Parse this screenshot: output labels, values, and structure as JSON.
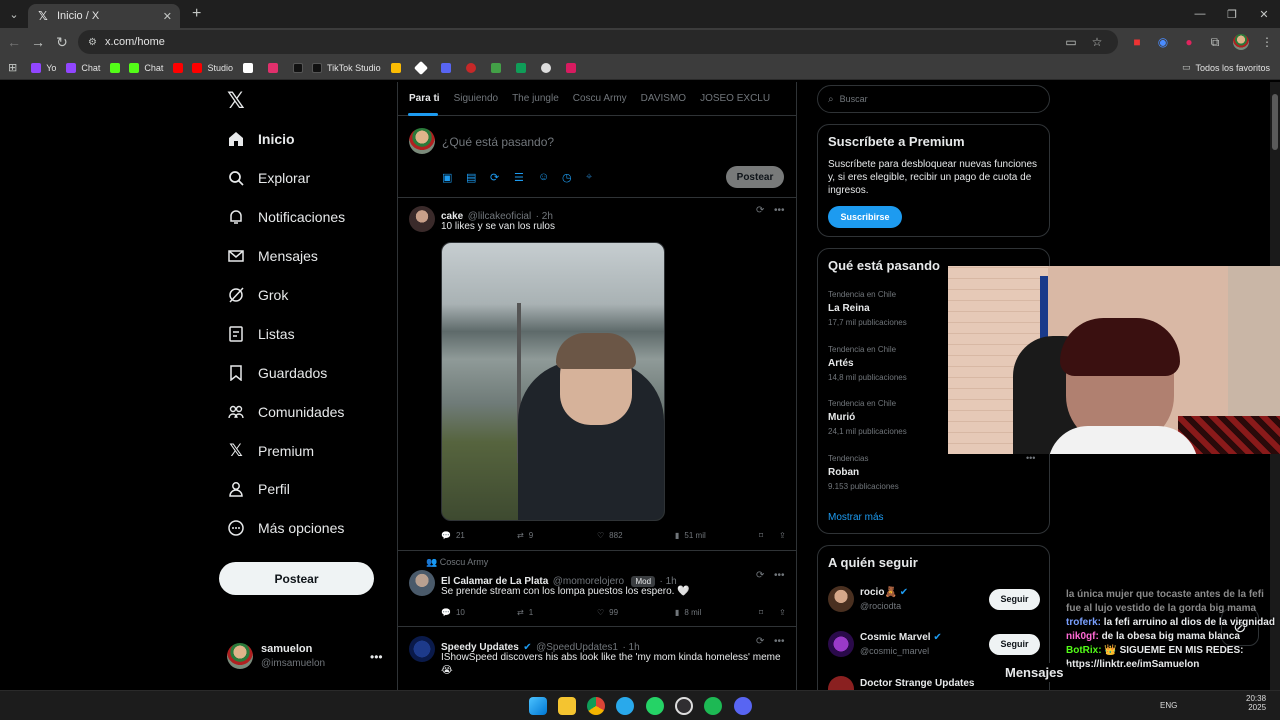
{
  "browser": {
    "tab_title": "Inicio / X",
    "url": "x.com/home",
    "bookmarks": [
      "Yo",
      "Chat",
      "Chat",
      "Studio",
      "TikTok Studio"
    ],
    "all_favorites": "Todos los favoritos"
  },
  "sidebar": {
    "items": [
      {
        "label": "Inicio",
        "icon": "home-icon"
      },
      {
        "label": "Explorar",
        "icon": "search-icon"
      },
      {
        "label": "Notificaciones",
        "icon": "bell-icon"
      },
      {
        "label": "Mensajes",
        "icon": "envelope-icon"
      },
      {
        "label": "Grok",
        "icon": "grok-icon"
      },
      {
        "label": "Listas",
        "icon": "list-icon"
      },
      {
        "label": "Guardados",
        "icon": "bookmark-icon"
      },
      {
        "label": "Comunidades",
        "icon": "people-icon"
      },
      {
        "label": "Premium",
        "icon": "x-icon"
      },
      {
        "label": "Perfil",
        "icon": "person-icon"
      },
      {
        "label": "Más opciones",
        "icon": "more-circle-icon"
      }
    ],
    "post_button": "Postear",
    "account": {
      "name": "samuelon",
      "handle": "@imsamuelon"
    }
  },
  "feed": {
    "tabs": [
      "Para ti",
      "Siguiendo",
      "The jungle",
      "Coscu Army",
      "DAVISMO",
      "JOSEO EXCLU"
    ],
    "composer_placeholder": "¿Qué está pasando?",
    "composer_post": "Postear",
    "tweets": [
      {
        "name": "cake",
        "handle": "@lilcakeoficial",
        "time": "· 2h",
        "text": "10 likes y se van los rulos",
        "replies": "21",
        "retweets": "9",
        "likes": "882",
        "views": "51 mil"
      },
      {
        "community": "Coscu Army",
        "name": "El Calamar de La Plata",
        "handle": "@momorelojero",
        "badge": "Mod",
        "time": "· 1h",
        "text": "Se prende stream con los lompa puestos los espero. 🤍",
        "replies": "10",
        "retweets": "1",
        "likes": "99",
        "views": "8 mil"
      },
      {
        "name": "Speedy Updates",
        "handle": "@SpeedUpdates1",
        "time": "· 1h",
        "text": "IShowSpeed discovers his abs look like the 'my mom kinda homeless' meme",
        "emoji": "😭"
      }
    ]
  },
  "right": {
    "search_placeholder": "Buscar",
    "premium": {
      "title": "Suscríbete a Premium",
      "text": "Suscríbete para desbloquear nuevas funciones y, si eres elegible, recibir un pago de cuota de ingresos.",
      "button": "Suscribirse"
    },
    "trends_title": "Qué está pasando",
    "trends": [
      {
        "context": "Tendencia en Chile",
        "name": "La Reina",
        "count": "17,7 mil publicaciones"
      },
      {
        "context": "Tendencia en Chile",
        "name": "Artés",
        "count": "14,8 mil publicaciones"
      },
      {
        "context": "Tendencia en Chile",
        "name": "Murió",
        "count": "24,1 mil publicaciones"
      },
      {
        "context": "Tendencias",
        "name": "Roban",
        "count": "9.153 publicaciones"
      }
    ],
    "show_more": "Mostrar más",
    "follow_title": "A quién seguir",
    "follow": [
      {
        "name": "rocio🧸",
        "handle": "@rociodta",
        "button": "Seguir"
      },
      {
        "name": "Cosmic Marvel",
        "handle": "@cosmic_marvel",
        "button": "Seguir"
      },
      {
        "name": "Doctor Strange Updates",
        "handle": ""
      }
    ]
  },
  "messages_bar": "Mensajes",
  "overlay_chat": [
    {
      "user": "",
      "text": "la única mujer que tocaste antes de la fefi fue al lujo vestido de la gorda big mama"
    },
    {
      "user": "troferk:",
      "text": "la fefi arruino al dios de la virgnidad"
    },
    {
      "user": "nik0gf:",
      "text": "de la obesa big mama blanca"
    },
    {
      "user": "BotRix:",
      "text": "👑 SIGUEME EN MIS REDES: https://linktr.ee/imSamuelon"
    }
  ],
  "taskbar": {
    "time": "20:38",
    "date": "2025",
    "lang": "ENG"
  },
  "colors": {
    "accent": "#1d9bf0",
    "background": "#000000",
    "border": "#2f3336",
    "muted": "#71767b"
  }
}
